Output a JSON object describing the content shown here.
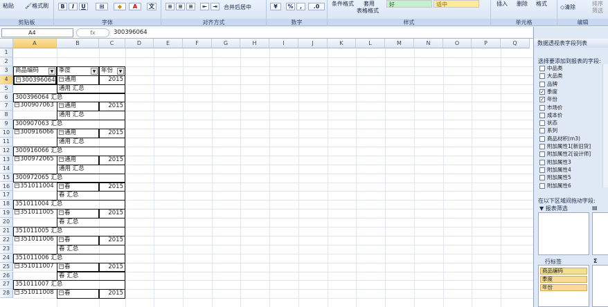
{
  "ribbon": {
    "paste": "粘贴",
    "format_painter": "格式刷",
    "bold": "B",
    "italic": "I",
    "underline": "U",
    "merge_center": "合并后居中",
    "percent": "%",
    "comma": ",",
    "cond_format": "条件格式",
    "table_format_line1": "套用",
    "table_format_line2": "表格格式",
    "style_good": "好",
    "style_neutral": "适中",
    "insert": "插入",
    "delete": "删除",
    "format": "格式",
    "clear": "清除",
    "sort_line1": "排序",
    "sort_line2": "筛选",
    "groups": [
      "剪贴板",
      "字体",
      "对齐方式",
      "数字",
      "样式",
      "单元格",
      "编辑"
    ]
  },
  "formula_bar": {
    "name_box": "A4",
    "fx": "fx",
    "content": "300396064"
  },
  "columns": [
    "A",
    "B",
    "C",
    "D",
    "E",
    "F",
    "G",
    "H",
    "I",
    "J",
    "K",
    "L",
    "M",
    "N",
    "O",
    "P",
    "Q"
  ],
  "rows": [
    "1",
    "2",
    "3",
    "4",
    "5",
    "6",
    "7",
    "8",
    "9",
    "10",
    "11",
    "12",
    "13",
    "14",
    "15",
    "16",
    "17",
    "18",
    "19",
    "20",
    "21",
    "22",
    "23",
    "24",
    "25",
    "26",
    "27",
    "28"
  ],
  "pivot": {
    "headers": [
      "商品编码",
      "季度",
      "年份"
    ],
    "row3": {
      "a": "商品编码",
      "b": "季度",
      "c": "年份"
    },
    "r4": {
      "a": "300396064",
      "b": "通用",
      "c": "2015"
    },
    "r5": {
      "b": "通用 汇总"
    },
    "r6": {
      "a": "300396064 汇总"
    },
    "r7": {
      "a": "300907063",
      "b": "通用",
      "c": "2015"
    },
    "r8": {
      "b": "通用 汇总"
    },
    "r9": {
      "a": "300907063 汇总"
    },
    "r10": {
      "a": "300916066",
      "b": "通用",
      "c": "2015"
    },
    "r11": {
      "b": "通用 汇总"
    },
    "r12": {
      "a": "300916066 汇总"
    },
    "r13": {
      "a": "300972065",
      "b": "通用",
      "c": "2015"
    },
    "r14": {
      "b": "通用 汇总"
    },
    "r15": {
      "a": "300972065 汇总"
    },
    "r16": {
      "a": "351011004",
      "b": "春",
      "c": "2015"
    },
    "r17": {
      "b": "春 汇总"
    },
    "r18": {
      "a": "351011004 汇总"
    },
    "r19": {
      "a": "351011005",
      "b": "春",
      "c": "2015"
    },
    "r20": {
      "b": "春 汇总"
    },
    "r21": {
      "a": "351011005 汇总"
    },
    "r22": {
      "a": "351011006",
      "b": "春",
      "c": "2015"
    },
    "r23": {
      "b": "春 汇总"
    },
    "r24": {
      "a": "351011006 汇总"
    },
    "r25": {
      "a": "351011007",
      "b": "春",
      "c": "2015"
    },
    "r26": {
      "b": "春 汇总"
    },
    "r27": {
      "a": "351011007 汇总"
    },
    "r28": {
      "a": "351011008",
      "b": "春",
      "c": "2015"
    }
  },
  "panel": {
    "title": "数据透视表字段列表",
    "choose_label": "选择要添加到报表的字段:",
    "fields": [
      {
        "label": "中品类",
        "checked": ""
      },
      {
        "label": "大品类",
        "checked": ""
      },
      {
        "label": "品牌",
        "checked": ""
      },
      {
        "label": "季度",
        "checked": "✓"
      },
      {
        "label": "年份",
        "checked": "✓"
      },
      {
        "label": "市场价",
        "checked": ""
      },
      {
        "label": "成本价",
        "checked": ""
      },
      {
        "label": "状态",
        "checked": ""
      },
      {
        "label": "系列",
        "checked": ""
      },
      {
        "label": "商品材积(m3)",
        "checked": ""
      },
      {
        "label": "附加属性1[新旧货]",
        "checked": ""
      },
      {
        "label": "附加属性2[设计师]",
        "checked": ""
      },
      {
        "label": "附加属性3",
        "checked": ""
      },
      {
        "label": "附加属性4",
        "checked": ""
      },
      {
        "label": "附加属性5",
        "checked": ""
      },
      {
        "label": "附加属性6",
        "checked": ""
      }
    ],
    "drag_label": "在以下区域间拖动字段:",
    "report_filter": "报表筛选",
    "row_label_title": "行标签",
    "sigma": "Σ",
    "row_items": [
      "商品编码",
      "季度",
      "年份"
    ]
  }
}
